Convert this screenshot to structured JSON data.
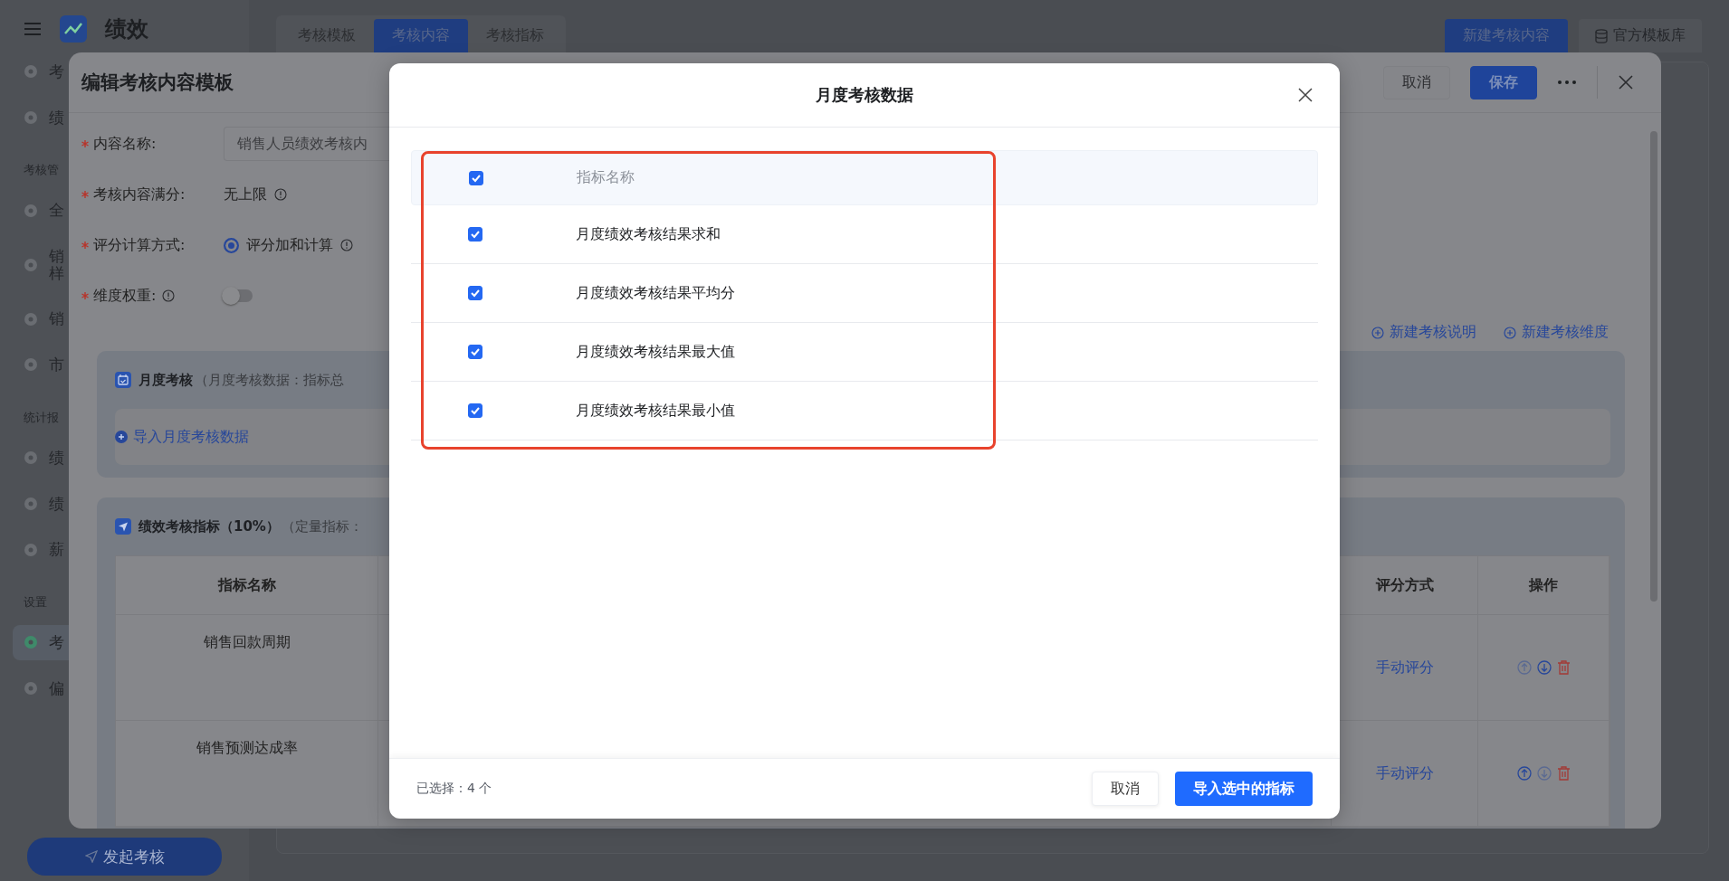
{
  "app": {
    "title": "绩效",
    "sidebar": {
      "items": [
        {
          "kind": "item",
          "label": "考",
          "selected": false
        },
        {
          "kind": "item",
          "label": "绩",
          "selected": false
        },
        {
          "kind": "section",
          "label": "考核管"
        },
        {
          "kind": "item",
          "label": "全",
          "selected": false
        },
        {
          "kind": "item",
          "label": "销样",
          "selected": false
        },
        {
          "kind": "item",
          "label": "销",
          "selected": false
        },
        {
          "kind": "item",
          "label": "市",
          "selected": false
        },
        {
          "kind": "section",
          "label": "统计报"
        },
        {
          "kind": "item",
          "label": "绩",
          "selected": false
        },
        {
          "kind": "item",
          "label": "绩",
          "selected": false
        },
        {
          "kind": "item",
          "label": "薪",
          "selected": false
        },
        {
          "kind": "section",
          "label": "设置"
        },
        {
          "kind": "item",
          "label": "考",
          "selected": true
        },
        {
          "kind": "item",
          "label": "偏",
          "selected": false
        }
      ],
      "launch_button": "发起考核"
    },
    "tabs": [
      {
        "label": "考核模板",
        "selected": false
      },
      {
        "label": "考核内容",
        "selected": true
      },
      {
        "label": "考核指标",
        "selected": false
      }
    ],
    "actions": {
      "primary": "新建考核内容",
      "secondary": "官方模板库"
    }
  },
  "drawer": {
    "title": "编辑考核内容模板",
    "cancel": "取消",
    "save": "保存",
    "fields": [
      {
        "kind": "input",
        "label": "内容名称:",
        "required": true,
        "value": "销售人员绩效考核内"
      },
      {
        "kind": "text",
        "label": "考核内容满分:",
        "required": true,
        "value": "无上限"
      },
      {
        "kind": "radio",
        "label": "评分计算方式:",
        "required": true,
        "value": "评分加和计算",
        "selected": true
      },
      {
        "kind": "switch",
        "label": "维度权重:",
        "required": true,
        "on": false
      }
    ],
    "links": [
      "新建考核说明",
      "新建考核维度"
    ],
    "sections": [
      {
        "kind": "import",
        "title": "月度考核",
        "note": "（月度考核数据：指标总",
        "action": "导入月度考核数据"
      },
      {
        "kind": "table",
        "title": "绩效考核指标（10%）",
        "note": "（定量指标：",
        "columns": [
          "指标名称",
          "评分方式",
          "操作"
        ],
        "rows": [
          {
            "name": "销售回款周期",
            "scoring": "手动评分",
            "up_disabled": true,
            "down_disabled": false
          },
          {
            "name": "销售预测达成率",
            "scoring": "手动评分",
            "up_disabled": false,
            "down_disabled": true
          }
        ]
      }
    ]
  },
  "modal": {
    "title": "月度考核数据",
    "header": {
      "label": "指标名称",
      "checked": true
    },
    "rows": [
      {
        "name": "月度绩效考核结果求和",
        "checked": true
      },
      {
        "name": "月度绩效考核结果平均分",
        "checked": true
      },
      {
        "name": "月度绩效考核结果最大值",
        "checked": true
      },
      {
        "name": "月度绩效考核结果最小值",
        "checked": true
      }
    ],
    "selection_count": "已选择：4 个",
    "cancel": "取消",
    "confirm": "导入选中的指标"
  }
}
